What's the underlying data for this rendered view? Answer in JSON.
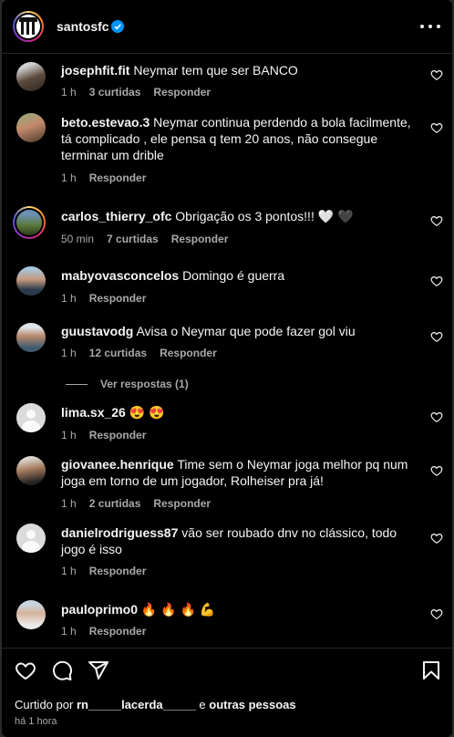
{
  "post": {
    "account": "santosfc",
    "more_icon": "more-horizontal-icon"
  },
  "comments": [
    {
      "user": "josephfit.fit",
      "text": "Neymar tem que ser BANCO",
      "time": "1 h",
      "likes": "3 curtidas",
      "reply": "Responder"
    },
    {
      "user": "beto.estevao.3",
      "text": "Neymar continua perdendo a bola facilmente, tá complicado , ele pensa q tem 20 anos, não consegue terminar um drible",
      "time": "1 h",
      "likes": "",
      "reply": "Responder"
    },
    {
      "user": "carlos_thierry_ofc",
      "text": "Obrigação os 3 pontos!!! 🤍 🖤",
      "time": "50 min",
      "likes": "7 curtidas",
      "reply": "Responder"
    },
    {
      "user": "mabyovasconcelos",
      "text": "Domingo é guerra",
      "time": "1 h",
      "likes": "",
      "reply": "Responder"
    },
    {
      "user": "guustavodg",
      "text": "Avisa o Neymar que pode fazer gol viu",
      "time": "1 h",
      "likes": "12 curtidas",
      "reply": "Responder",
      "view_replies": "Ver respostas (1)"
    },
    {
      "user": "lima.sx_26",
      "text": "😍 😍",
      "time": "1 h",
      "likes": "",
      "reply": "Responder"
    },
    {
      "user": "giovanee.henrique",
      "text": "Time sem o Neymar joga melhor pq num joga em torno de um jogador, Rolheiser pra já!",
      "time": "1 h",
      "likes": "2 curtidas",
      "reply": "Responder"
    },
    {
      "user": "danielrodriguess87",
      "text": "vão ser roubado dnv no clássico, todo jogo é isso",
      "time": "1 h",
      "likes": "",
      "reply": "Responder"
    },
    {
      "user": "pauloprimo0",
      "text": "🔥 🔥 🔥 💪",
      "time": "1 h",
      "likes": "",
      "reply": "Responder"
    }
  ],
  "footer": {
    "liked_prefix": "Curtido por",
    "liked_user": "rn_____lacerda_____",
    "liked_conj": "e",
    "liked_rest": "outras pessoas",
    "age": "há 1 hora"
  },
  "colors": {
    "background": "#000000",
    "text": "#f5f5f5",
    "secondary": "#a8a8a8",
    "verified": "#0095f6"
  }
}
